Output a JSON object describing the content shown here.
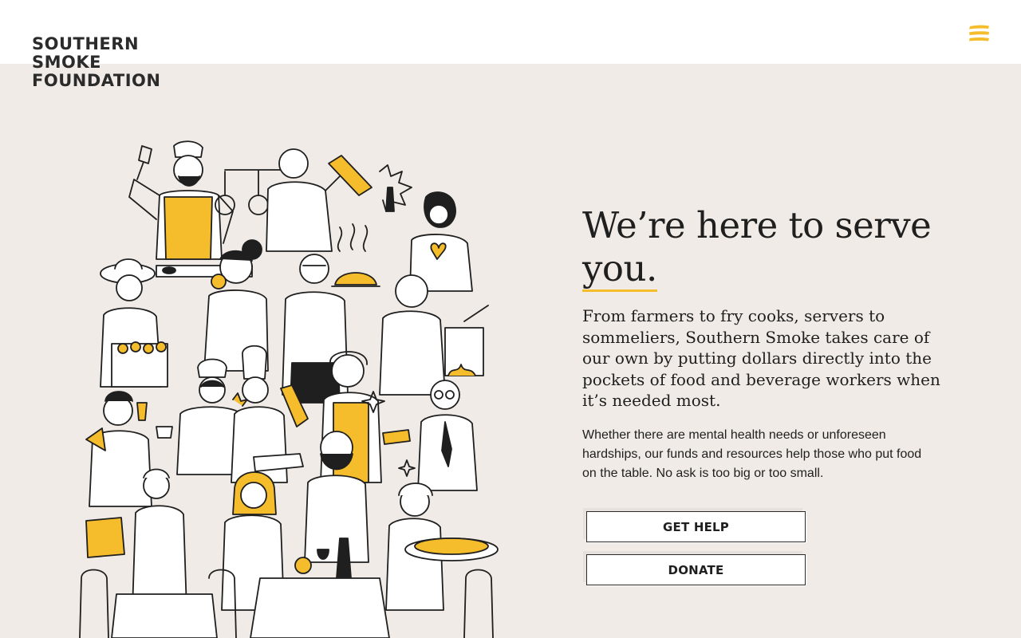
{
  "brand": {
    "logo_lines": [
      "SOUTHERN",
      "SMOKE",
      "FOUNDATION"
    ],
    "accent_color": "#f5bd2c",
    "background_color": "#f0ebe6",
    "ink_color": "#1f1f1f"
  },
  "header": {
    "menu_icon": "hamburger-menu-icon"
  },
  "hero": {
    "illustration": "hospitality-workers-illustration",
    "headline_main": "We’re here to serve",
    "headline_underlined": "you.",
    "lead": "From farmers to fry cooks, servers to sommeliers, Southern Smoke takes care of our own by putting dollars directly into the pockets of food and beverage workers when it’s needed most.",
    "body": "Whether there are mental health needs or unforeseen hardships, our funds and resources help those who put food on the table. No ask is too big or too small.",
    "buttons": {
      "get_help": "GET HELP",
      "donate": "DONATE"
    }
  }
}
